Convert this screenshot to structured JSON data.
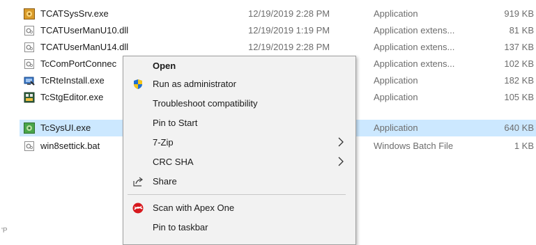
{
  "files": [
    {
      "name": "TCATSysSrv.exe",
      "date": "12/19/2019 2:28 PM",
      "type": "Application",
      "size": "919 KB",
      "icon": "exe-gear-icon"
    },
    {
      "name": "TCATUserManU10.dll",
      "date": "12/19/2019 1:19 PM",
      "type": "Application extens...",
      "size": "81 KB",
      "icon": "dll-icon"
    },
    {
      "name": "TCATUserManU14.dll",
      "date": "12/19/2019 2:28 PM",
      "type": "Application extens...",
      "size": "137 KB",
      "icon": "dll-icon"
    },
    {
      "name": "TcComPortConnec",
      "date": "",
      "type": "Application extens...",
      "size": "102 KB",
      "icon": "dll-icon"
    },
    {
      "name": "TcRteInstall.exe",
      "date": "",
      "type": "Application",
      "size": "182 KB",
      "icon": "installer-icon"
    },
    {
      "name": "TcStgEditor.exe",
      "date": "",
      "type": "Application",
      "size": "105 KB",
      "icon": "editor-icon"
    },
    {
      "name": "TcSysUI.exe",
      "date": "",
      "type": "Application",
      "size": "640 KB",
      "icon": "sysui-icon"
    },
    {
      "name": "win8settick.bat",
      "date": "",
      "type": "Windows Batch File",
      "size": "1 KB",
      "icon": "bat-icon"
    }
  ],
  "context_menu": {
    "open": "Open",
    "run_as_admin": "Run as administrator",
    "troubleshoot": "Troubleshoot compatibility",
    "pin_to_start": "Pin to Start",
    "seven_zip": "7-Zip",
    "crc_sha": "CRC SHA",
    "share": "Share",
    "scan_apex": "Scan with Apex One",
    "pin_taskbar": "Pin to taskbar"
  },
  "cutoff_text": "'P",
  "colors": {
    "selection": "#cce8ff",
    "menu_bg": "#f2f2f2",
    "apex_red": "#d7191e",
    "shield_blue": "#1f6fd1",
    "shield_yellow": "#f5c518"
  }
}
